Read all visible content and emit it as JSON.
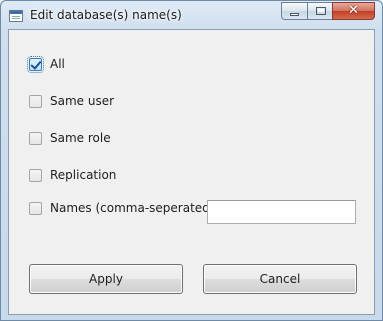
{
  "window": {
    "title": "Edit database(s) name(s)",
    "icon": "app-window-icon",
    "controls": {
      "minimize": "minimize-icon",
      "maximize": "maximize-icon",
      "close": "close-icon",
      "close_glyph": "✕"
    }
  },
  "options": [
    {
      "label": "All",
      "checked": true
    },
    {
      "label": "Same user",
      "checked": false
    },
    {
      "label": "Same role",
      "checked": false
    },
    {
      "label": "Replication",
      "checked": false
    },
    {
      "label": "Names (comma-seperated):",
      "checked": false
    }
  ],
  "names_input": {
    "value": "",
    "placeholder": ""
  },
  "buttons": {
    "apply": "Apply",
    "cancel": "Cancel"
  }
}
